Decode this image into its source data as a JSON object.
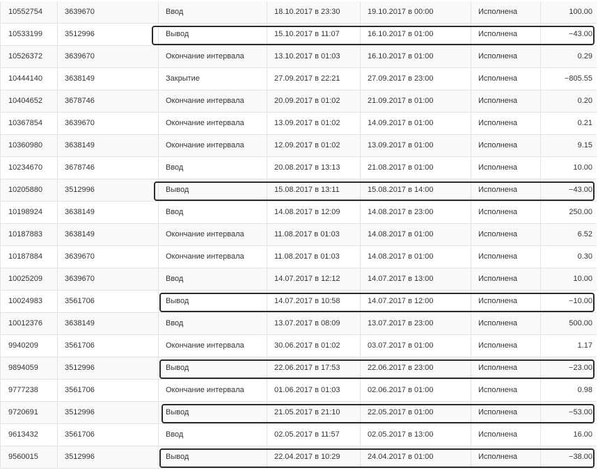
{
  "table": {
    "rows": [
      {
        "id": "10552754",
        "account": "3639670",
        "type": "Ввод",
        "start": "18.10.2017 в 23:30",
        "end": "19.10.2017 в 00:00",
        "status": "Исполнена",
        "amount": "100.00",
        "highlighted": false
      },
      {
        "id": "10533199",
        "account": "3512996",
        "type": "Вывод",
        "start": "15.10.2017 в 11:07",
        "end": "16.10.2017 в 01:00",
        "status": "Исполнена",
        "amount": "−43.00",
        "highlighted": true
      },
      {
        "id": "10526372",
        "account": "3639670",
        "type": "Окончание интервала",
        "start": "13.10.2017 в 01:03",
        "end": "16.10.2017 в 01:00",
        "status": "Исполнена",
        "amount": "0.29",
        "highlighted": false
      },
      {
        "id": "10444140",
        "account": "3638149",
        "type": "Закрытие",
        "start": "27.09.2017 в 22:21",
        "end": "27.09.2017 в 23:00",
        "status": "Исполнена",
        "amount": "−805.55",
        "highlighted": false
      },
      {
        "id": "10404652",
        "account": "3678746",
        "type": "Окончание интервала",
        "start": "20.09.2017 в 01:02",
        "end": "21.09.2017 в 01:00",
        "status": "Исполнена",
        "amount": "0.20",
        "highlighted": false
      },
      {
        "id": "10367854",
        "account": "3639670",
        "type": "Окончание интервала",
        "start": "13.09.2017 в 01:02",
        "end": "14.09.2017 в 01:00",
        "status": "Исполнена",
        "amount": "0.21",
        "highlighted": false
      },
      {
        "id": "10360980",
        "account": "3638149",
        "type": "Окончание интервала",
        "start": "12.09.2017 в 01:02",
        "end": "13.09.2017 в 01:00",
        "status": "Исполнена",
        "amount": "9.15",
        "highlighted": false
      },
      {
        "id": "10234670",
        "account": "3678746",
        "type": "Ввод",
        "start": "20.08.2017 в 13:13",
        "end": "21.08.2017 в 01:00",
        "status": "Исполнена",
        "amount": "10.00",
        "highlighted": false
      },
      {
        "id": "10205880",
        "account": "3512996",
        "type": "Вывод",
        "start": "15.08.2017 в 13:11",
        "end": "15.08.2017 в 14:00",
        "status": "Исполнена",
        "amount": "−43.00",
        "highlighted": true
      },
      {
        "id": "10198924",
        "account": "3638149",
        "type": "Ввод",
        "start": "14.08.2017 в 12:09",
        "end": "14.08.2017 в 23:00",
        "status": "Исполнена",
        "amount": "250.00",
        "highlighted": false
      },
      {
        "id": "10187883",
        "account": "3638149",
        "type": "Окончание интервала",
        "start": "11.08.2017 в 01:03",
        "end": "14.08.2017 в 01:00",
        "status": "Исполнена",
        "amount": "6.52",
        "highlighted": false
      },
      {
        "id": "10187884",
        "account": "3639670",
        "type": "Окончание интервала",
        "start": "11.08.2017 в 01:03",
        "end": "14.08.2017 в 01:00",
        "status": "Исполнена",
        "amount": "0.30",
        "highlighted": false
      },
      {
        "id": "10025209",
        "account": "3639670",
        "type": "Ввод",
        "start": "14.07.2017 в 12:12",
        "end": "14.07.2017 в 13:00",
        "status": "Исполнена",
        "amount": "10.00",
        "highlighted": false
      },
      {
        "id": "10024983",
        "account": "3561706",
        "type": "Вывод",
        "start": "14.07.2017 в 10:58",
        "end": "14.07.2017 в 12:00",
        "status": "Исполнена",
        "amount": "−10.00",
        "highlighted": true
      },
      {
        "id": "10012376",
        "account": "3638149",
        "type": "Ввод",
        "start": "13.07.2017 в 08:09",
        "end": "13.07.2017 в 23:00",
        "status": "Исполнена",
        "amount": "500.00",
        "highlighted": false
      },
      {
        "id": "9940209",
        "account": "3561706",
        "type": "Окончание интервала",
        "start": "30.06.2017 в 01:02",
        "end": "03.07.2017 в 01:00",
        "status": "Исполнена",
        "amount": "1.17",
        "highlighted": false
      },
      {
        "id": "9894059",
        "account": "3512996",
        "type": "Вывод",
        "start": "22.06.2017 в 17:53",
        "end": "22.06.2017 в 23:00",
        "status": "Исполнена",
        "amount": "−23.00",
        "highlighted": true
      },
      {
        "id": "9777238",
        "account": "3561706",
        "type": "Окончание интервала",
        "start": "01.06.2017 в 01:03",
        "end": "02.06.2017 в 01:00",
        "status": "Исполнена",
        "amount": "0.98",
        "highlighted": false
      },
      {
        "id": "9720691",
        "account": "3512996",
        "type": "Вывод",
        "start": "21.05.2017 в 21:10",
        "end": "22.05.2017 в 01:00",
        "status": "Исполнена",
        "amount": "−53.00",
        "highlighted": true
      },
      {
        "id": "9613432",
        "account": "3561706",
        "type": "Ввод",
        "start": "02.05.2017 в 11:57",
        "end": "02.05.2017 в 13:00",
        "status": "Исполнена",
        "amount": "16.00",
        "highlighted": false
      },
      {
        "id": "9560015",
        "account": "3512996",
        "type": "Вывод",
        "start": "22.04.2017 в 10:29",
        "end": "24.04.2017 в 01:00",
        "status": "Исполнена",
        "amount": "−38.00",
        "highlighted": true
      }
    ]
  },
  "colors": {
    "stripe": "#f9f9f9",
    "border": "#e3e3e3",
    "text": "#333333",
    "highlight": "#2b2b2b"
  }
}
